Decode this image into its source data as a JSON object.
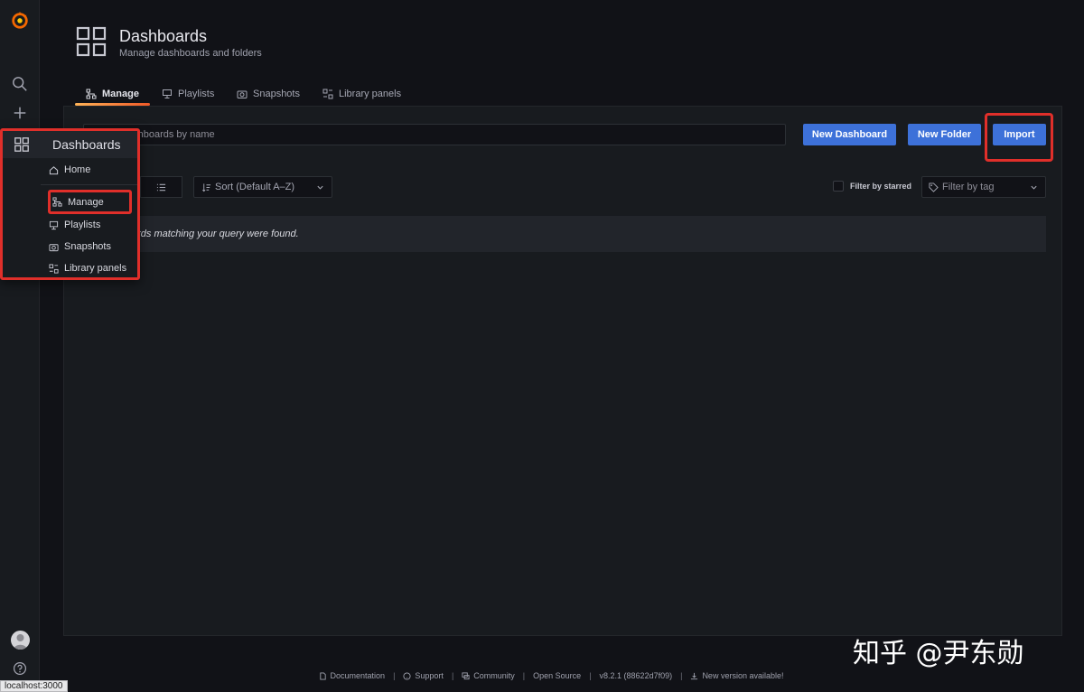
{
  "header": {
    "title": "Dashboards",
    "subtitle": "Manage dashboards and folders"
  },
  "tabs": [
    {
      "label": "Manage",
      "icon": "sitemap-icon",
      "active": true
    },
    {
      "label": "Playlists",
      "icon": "presentation-icon",
      "active": false
    },
    {
      "label": "Snapshots",
      "icon": "camera-icon",
      "active": false
    },
    {
      "label": "Library panels",
      "icon": "library-panel-icon",
      "active": false
    }
  ],
  "sidenav": {
    "items": [
      "grafana-logo",
      "search-icon",
      "plus-icon",
      "dashboards-icon",
      "explore-icon",
      "alerting-bell-icon",
      "configuration-gear-icon",
      "server-admin-shield-icon"
    ],
    "bottom": [
      "user-avatar",
      "help-icon"
    ]
  },
  "flyout": {
    "title": "Dashboards",
    "items": [
      {
        "label": "Home",
        "icon": "home-icon"
      },
      {
        "label": "Manage",
        "icon": "sitemap-icon"
      },
      {
        "label": "Playlists",
        "icon": "presentation-icon"
      },
      {
        "label": "Snapshots",
        "icon": "camera-icon"
      },
      {
        "label": "Library panels",
        "icon": "library-panel-icon"
      }
    ]
  },
  "toolbar": {
    "search_placeholder": "ashboards by name",
    "new_dashboard": "New Dashboard",
    "new_folder": "New Folder",
    "import": "Import"
  },
  "filters": {
    "sort": "Sort (Default A–Z)",
    "filter_starred": "Filter by starred",
    "filter_tag": "Filter by tag"
  },
  "results": {
    "empty_message": "ards matching your query were found."
  },
  "footer": {
    "documentation": "Documentation",
    "support": "Support",
    "community": "Community",
    "open_source": "Open Source",
    "version": "v8.2.1 (88622d7f09)",
    "new_version": "New version available!",
    "separator": "|"
  },
  "status_url": "localhost:3000",
  "watermark": "知乎 @尹东勋",
  "colors": {
    "primary_button": "#3d71d9",
    "highlight": "#e02f2a",
    "tab_accent": "#f05a28"
  }
}
